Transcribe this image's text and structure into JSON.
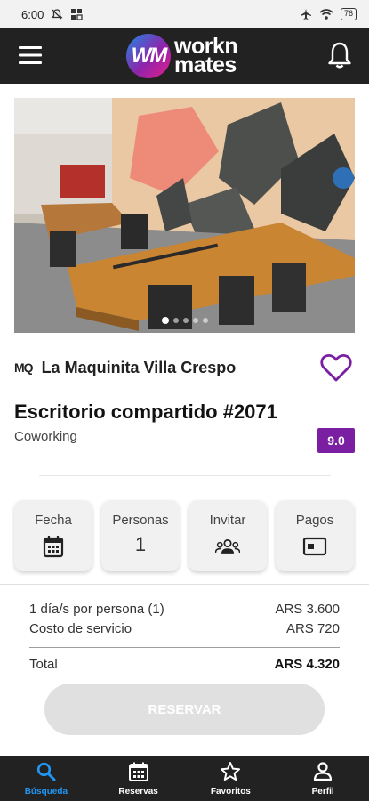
{
  "status_bar": {
    "time": "6:00",
    "battery": "76"
  },
  "header": {
    "logo_mark": "WM",
    "logo_line1": "workn",
    "logo_line2": "mates"
  },
  "venue": {
    "logo_text": "MQ",
    "name": "La Maquinita Villa Crespo"
  },
  "listing": {
    "title": "Escritorio compartido #2071",
    "category": "Coworking",
    "rating": "9.0"
  },
  "photo": {
    "slides": 5,
    "active_slide": 1
  },
  "options": {
    "fecha_label": "Fecha",
    "personas_label": "Personas",
    "personas_value": "1",
    "invitar_label": "Invitar",
    "pagos_label": "Pagos"
  },
  "pricing": {
    "per_person_label": "1 día/s por persona (1)",
    "per_person_value": "ARS 3.600",
    "service_label": "Costo de servicio",
    "service_value": "ARS 720",
    "total_label": "Total",
    "total_value": "ARS 4.320"
  },
  "reserve_button": "RESERVAR",
  "bottom_nav": [
    {
      "label": "Búsqueda",
      "icon": "search-icon",
      "active": true
    },
    {
      "label": "Reservas",
      "icon": "calendar-icon",
      "active": false
    },
    {
      "label": "Favoritos",
      "icon": "star-icon",
      "active": false
    },
    {
      "label": "Perfil",
      "icon": "person-icon",
      "active": false
    }
  ],
  "colors": {
    "accent": "#7b1fa2",
    "nav_active": "#2196f3",
    "bar_bg": "#222222"
  }
}
